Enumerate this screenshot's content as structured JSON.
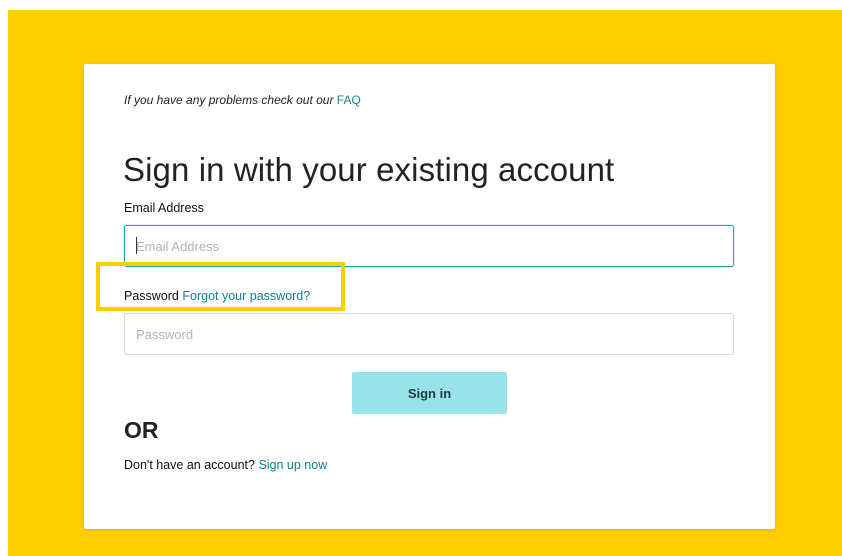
{
  "faq": {
    "prefix": "If you have any problems check out our",
    "link": "FAQ"
  },
  "title": "Sign in with your existing account",
  "email": {
    "label": "Email Address",
    "placeholder": "Email Address",
    "value": ""
  },
  "password": {
    "label": "Password",
    "forgot_link": "Forgot your password?",
    "placeholder": "Password",
    "value": ""
  },
  "signin_button": "Sign in",
  "or_text": "OR",
  "signup": {
    "prefix": "Don't have an account?",
    "link": "Sign up now"
  },
  "colors": {
    "background": "#ffcd00",
    "link": "#11808c",
    "button": "#98e3ea",
    "focus_border": "#1ea6ae",
    "highlight": "#ffcd00"
  }
}
